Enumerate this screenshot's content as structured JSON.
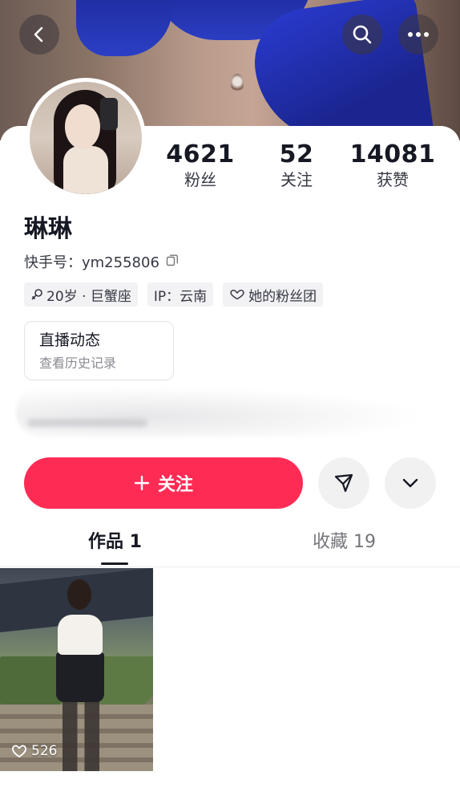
{
  "profile": {
    "name": "琳琳",
    "kuaishou_id": "快手号：ym255806"
  },
  "stats": [
    {
      "value": "4621",
      "label": "粉丝"
    },
    {
      "value": "52",
      "label": "关注"
    },
    {
      "value": "14081",
      "label": "获赞"
    }
  ],
  "tags": [
    {
      "icon": "female-icon",
      "text": "20岁 · 巨蟹座"
    },
    {
      "icon": "",
      "text": "IP：云南"
    },
    {
      "icon": "fan-club-icon",
      "text": "她的粉丝团"
    }
  ],
  "live_card": {
    "title": "直播动态",
    "subtitle": "查看历史记录"
  },
  "actions": {
    "follow_label": "关注",
    "share_icon": "send-icon",
    "more_icon": "chevron-down-icon"
  },
  "tabs": [
    {
      "label": "作品 1",
      "active": true
    },
    {
      "label": "收藏 19",
      "active": false
    }
  ],
  "works": [
    {
      "likes": "526"
    }
  ],
  "colors": {
    "accent": "#fe2c55",
    "text_primary": "#161823",
    "text_secondary": "#75767c",
    "tag_bg": "#f2f2f4"
  }
}
